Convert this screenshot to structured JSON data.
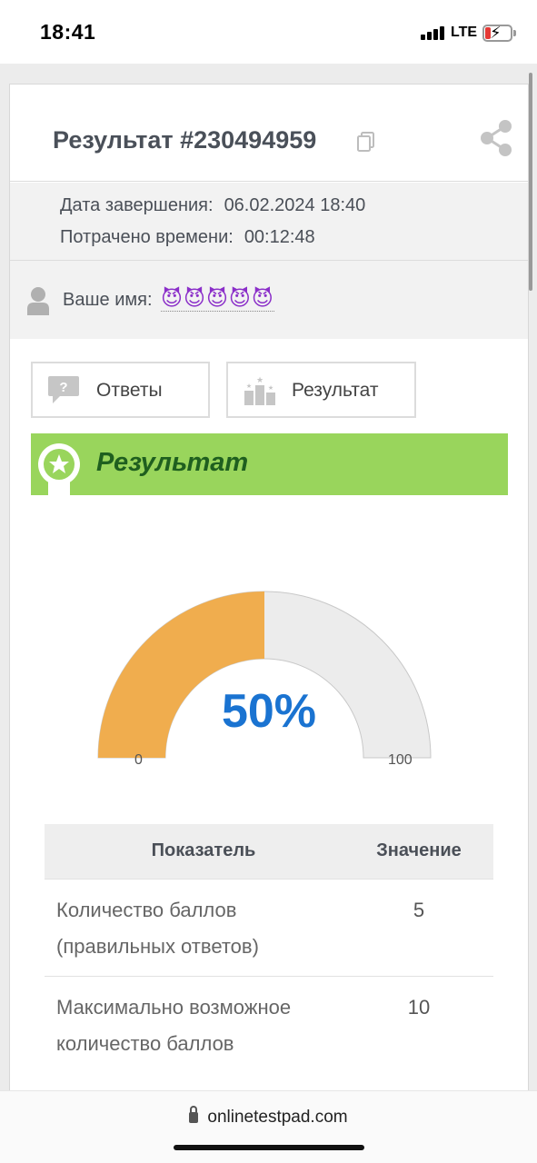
{
  "status_bar": {
    "time": "18:41",
    "network": "LTE"
  },
  "result": {
    "title": "Результат #230494959",
    "copy_icon": "copy-icon",
    "share_icon": "share-icon"
  },
  "info": {
    "finish_label": "Дата завершения:",
    "finish_value": "06.02.2024 18:40",
    "spent_label": "Потрачено времени:",
    "spent_value": "00:12:48"
  },
  "user": {
    "name_label": "Ваше имя:",
    "name_value": "😈😈😈😈😈"
  },
  "tabs": {
    "answers": "Ответы",
    "result": "Результат"
  },
  "banner": {
    "title": "Результат"
  },
  "gauge": {
    "value_percent": 50,
    "value_text": "50%",
    "min": "0",
    "max": "100",
    "fill_color": "#f0ad4e",
    "track_color": "#ececec"
  },
  "table": {
    "headers": [
      "Показатель",
      "Значение"
    ],
    "rows": [
      {
        "metric": "Количество баллов (правильных ответов)",
        "value": "5"
      },
      {
        "metric": "Максимально возможное количество баллов",
        "value": "10"
      }
    ]
  },
  "browser": {
    "url": "onlinetestpad.com"
  },
  "colors": {
    "accent": "#1a73d1",
    "banner": "#99d55c",
    "banner_text": "#1f5f1f"
  }
}
